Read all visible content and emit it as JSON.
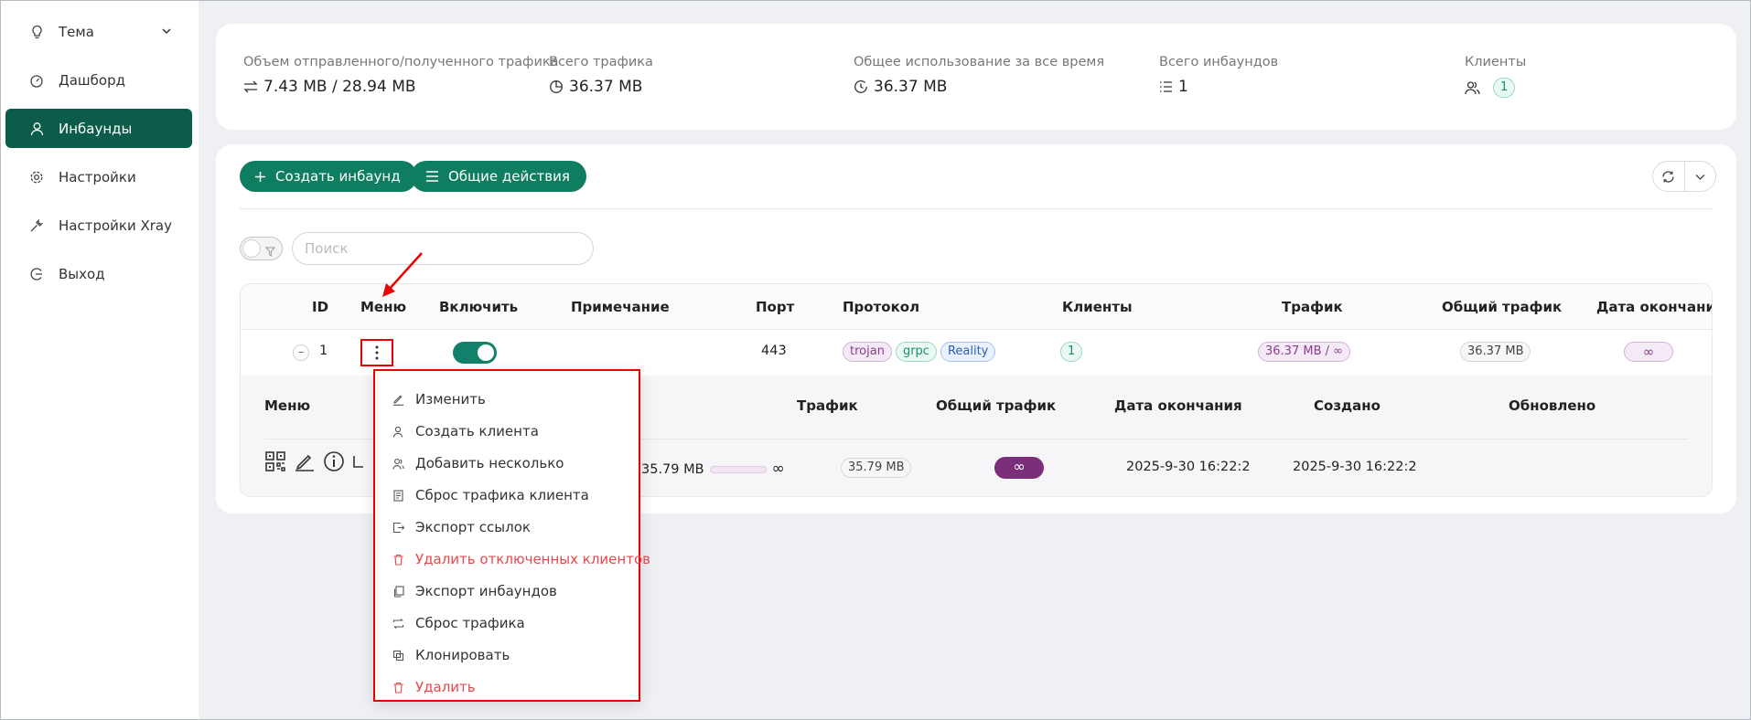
{
  "sidebar": {
    "items": [
      {
        "label": "Тема",
        "icon": "bulb-icon"
      },
      {
        "label": "Дашборд",
        "icon": "dashboard-icon"
      },
      {
        "label": "Инбаунды",
        "icon": "user-icon"
      },
      {
        "label": "Настройки",
        "icon": "gear-icon"
      },
      {
        "label": "Настройки Xray",
        "icon": "tool-icon"
      },
      {
        "label": "Выход",
        "icon": "logout-icon"
      }
    ],
    "active_index": 2
  },
  "stats": {
    "traffic_label": "Объем отправленного/полученного трафика",
    "traffic_value": "7.43 MB / 28.94 MB",
    "total_label": "Всего трафика",
    "total_value": "36.37 MB",
    "alltime_label": "Общее использование за все время",
    "alltime_value": "36.37 MB",
    "inbounds_label": "Всего инбаундов",
    "inbounds_value": "1",
    "clients_label": "Клиенты",
    "clients_value": "1"
  },
  "toolbar": {
    "create_label": "Создать инбаунд",
    "actions_label": "Общие действия",
    "search_placeholder": "Поиск"
  },
  "table": {
    "headers": {
      "id": "ID",
      "menu": "Меню",
      "enable": "Включить",
      "remark": "Примечание",
      "port": "Порт",
      "protocol": "Протокол",
      "clients": "Клиенты",
      "traffic": "Трафик",
      "total_traffic": "Общий трафик",
      "expiry": "Дата окончания"
    },
    "row": {
      "id": "1",
      "port": "443",
      "protocol_tags": [
        "trojan",
        "grpc",
        "Reality"
      ],
      "clients": "1",
      "traffic": "36.37 MB / ∞",
      "total_traffic": "36.37 MB",
      "expiry": "∞",
      "enabled": true
    },
    "sub": {
      "headers": {
        "menu": "Меню",
        "traffic": "Трафик",
        "total_traffic": "Общий трафик",
        "expiry": "Дата окончания",
        "created": "Создано",
        "updated": "Обновлено"
      },
      "row": {
        "traffic": "35.79 MB",
        "traffic_limit": "∞",
        "total_traffic": "35.79 MB",
        "expiry": "∞",
        "created": "2025-9-30 16:22:2",
        "updated": "2025-9-30 16:22:2"
      }
    }
  },
  "dropdown": {
    "items": [
      {
        "label": "Изменить",
        "icon": "edit-icon",
        "danger": false
      },
      {
        "label": "Создать клиента",
        "icon": "user-add-icon",
        "danger": false
      },
      {
        "label": "Добавить несколько",
        "icon": "users-add-icon",
        "danger": false
      },
      {
        "label": "Сброс трафика клиента",
        "icon": "file-reset-icon",
        "danger": false
      },
      {
        "label": "Экспорт ссылок",
        "icon": "export-icon",
        "danger": false
      },
      {
        "label": "Удалить отключенных клиентов",
        "icon": "trash-icon",
        "danger": true
      },
      {
        "label": "Экспорт инбаундов",
        "icon": "copy-icon",
        "danger": false
      },
      {
        "label": "Сброс трафика",
        "icon": "retweet-icon",
        "danger": false
      },
      {
        "label": "Клонировать",
        "icon": "block-icon",
        "danger": false
      },
      {
        "label": "Удалить",
        "icon": "delete-icon",
        "danger": true
      }
    ]
  },
  "colors": {
    "accent": "#0f7d60",
    "sidebar_active": "#0b5c49",
    "danger": "#e5484d",
    "highlight": "#ee0000"
  }
}
